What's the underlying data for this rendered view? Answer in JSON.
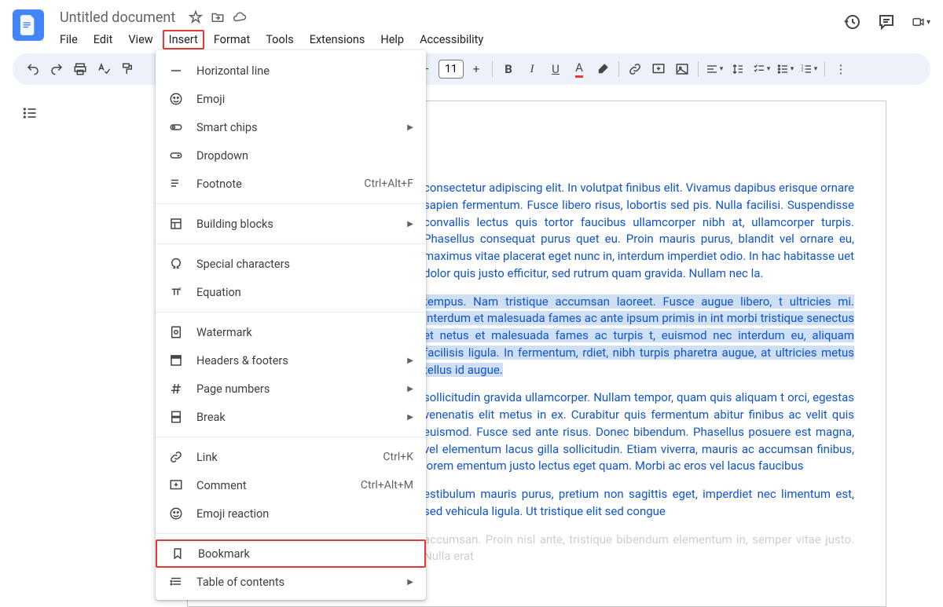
{
  "doc_title": "Untitled document",
  "menus": [
    "File",
    "Edit",
    "View",
    "Insert",
    "Format",
    "Tools",
    "Extensions",
    "Help",
    "Accessibility"
  ],
  "highlighted_menu": 3,
  "font_size": "11",
  "dropdown": [
    {
      "label": "Horizontal line",
      "icon": "hline"
    },
    {
      "label": "Emoji",
      "icon": "emoji"
    },
    {
      "label": "Smart chips",
      "icon": "chip",
      "sub": true
    },
    {
      "label": "Dropdown",
      "icon": "dropdown"
    },
    {
      "label": "Footnote",
      "icon": "footnote",
      "shortcut": "Ctrl+Alt+F"
    },
    {
      "sep": true
    },
    {
      "label": "Building blocks",
      "icon": "blocks",
      "sub": true
    },
    {
      "sep": true
    },
    {
      "label": "Special characters",
      "icon": "omega"
    },
    {
      "label": "Equation",
      "icon": "pi"
    },
    {
      "sep": true
    },
    {
      "label": "Watermark",
      "icon": "watermark"
    },
    {
      "label": "Headers & footers",
      "icon": "headers",
      "sub": true
    },
    {
      "label": "Page numbers",
      "icon": "hash",
      "sub": true
    },
    {
      "label": "Break",
      "icon": "break",
      "sub": true
    },
    {
      "sep": true
    },
    {
      "label": "Link",
      "icon": "link",
      "shortcut": "Ctrl+K"
    },
    {
      "label": "Comment",
      "icon": "comment",
      "shortcut": "Ctrl+Alt+M"
    },
    {
      "label": "Emoji reaction",
      "icon": "emoji"
    },
    {
      "sep": true
    },
    {
      "label": "Bookmark",
      "icon": "bookmark",
      "hl": true
    },
    {
      "label": "Table of contents",
      "icon": "toc",
      "sub": true
    }
  ],
  "paragraphs": [
    "consectetur adipiscing elit. In volutpat finibus elit. Vivamus dapibus erisque ornare sapien fermentum. Fusce libero risus, lobortis sed pis. Nulla facilisi. Suspendisse convallis lectus quis tortor faucibus ullamcorper nibh at, ullamcorper turpis. Phasellus consequat purus quet eu. Proin mauris purus, blandit vel ornare eu, maximus vitae placerat eget nunc in, interdum imperdiet odio. In hac habitasse uet dolor quis justo efficitur, sed rutrum quam gravida. Nullam nec la.",
    "tempus. Nam tristique accumsan laoreet. Fusce augue libero, t ultricies mi. Interdum et malesuada fames ac ante ipsum primis in int morbi tristique senectus et netus et malesuada fames ac turpis t, euismod nec interdum eu, aliquam facilisis ligula. In fermentum, rdiet, nibh turpis pharetra augue, at ultricies metus tellus id augue.",
    "sollicitudin gravida ullamcorper. Nullam tempor, quam quis aliquam t orci, egestas venenatis elit metus in ex. Curabitur quis fermentum abitur finibus ac velit quis euismod. Fusce sed ante risus. Donec bibendum. Phasellus posuere est magna, vel elementum lacus gilla sollicitudin. Etiam viverra, mauris ac accumsan finibus, lorem ementum justo lectus eget quam. Morbi ac eros vel lacus faucibus",
    "estibulum mauris purus, pretium non sagittis eget, imperdiet nec limentum est, sed vehicula ligula. Ut tristique elit sed congue"
  ],
  "cut_text": "accumsan. Proin nisl ante, tristique bibendum elementum in, semper vitae justo. Nulla erat",
  "selected_para": 1
}
